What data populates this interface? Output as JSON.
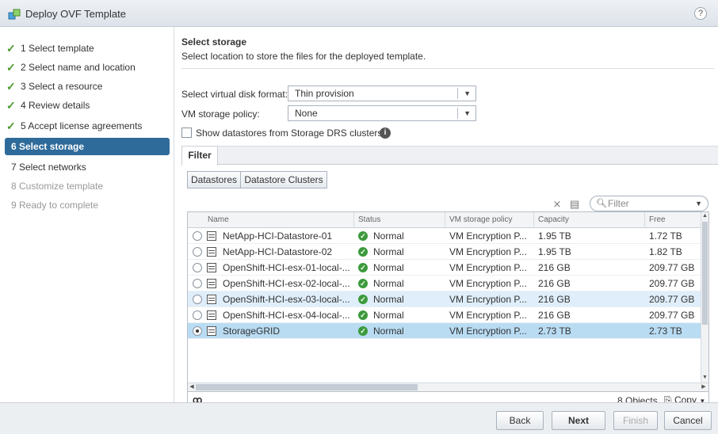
{
  "window": {
    "title": "Deploy OVF Template",
    "help": "?"
  },
  "steps": [
    {
      "label": "1  Select template",
      "state": "done"
    },
    {
      "label": "2  Select name and location",
      "state": "done"
    },
    {
      "label": "3  Select a resource",
      "state": "done"
    },
    {
      "label": "4  Review details",
      "state": "done"
    },
    {
      "label": "5  Accept license agreements",
      "state": "done"
    },
    {
      "label": "6  Select storage",
      "state": "active"
    },
    {
      "label": "7  Select networks",
      "state": "todo"
    },
    {
      "label": "8  Customize template",
      "state": "pending"
    },
    {
      "label": "9  Ready to complete",
      "state": "pending"
    }
  ],
  "main": {
    "title": "Select storage",
    "subtitle": "Select location to store the files for the deployed template.",
    "disk_format_label": "Select virtual disk format:",
    "disk_format_value": "Thin provision",
    "policy_label": "VM storage policy:",
    "policy_value": "None",
    "show_drs_label": "Show datastores from Storage DRS clusters",
    "filter_tab": "Filter",
    "segments": [
      "Datastores",
      "Datastore Clusters"
    ],
    "filter_placeholder": "Filter"
  },
  "table": {
    "columns": [
      "Name",
      "Status",
      "VM storage policy",
      "Capacity",
      "Free"
    ],
    "rows": [
      {
        "name": "NetApp-HCI-Datastore-01",
        "status": "Normal",
        "policy": "VM Encryption P...",
        "capacity": "1.95  TB",
        "free": "1.72  TB",
        "selected": false
      },
      {
        "name": "NetApp-HCI-Datastore-02",
        "status": "Normal",
        "policy": "VM Encryption P...",
        "capacity": "1.95  TB",
        "free": "1.82  TB",
        "selected": false
      },
      {
        "name": "OpenShift-HCI-esx-01-local-...",
        "status": "Normal",
        "policy": "VM Encryption P...",
        "capacity": "216  GB",
        "free": "209.77  GB",
        "selected": false
      },
      {
        "name": "OpenShift-HCI-esx-02-local-...",
        "status": "Normal",
        "policy": "VM Encryption P...",
        "capacity": "216  GB",
        "free": "209.77  GB",
        "selected": false
      },
      {
        "name": "OpenShift-HCI-esx-03-local-...",
        "status": "Normal",
        "policy": "VM Encryption P...",
        "capacity": "216  GB",
        "free": "209.77  GB",
        "selected": false
      },
      {
        "name": "OpenShift-HCI-esx-04-local-...",
        "status": "Normal",
        "policy": "VM Encryption P...",
        "capacity": "216  GB",
        "free": "209.77  GB",
        "selected": false
      },
      {
        "name": "StorageGRID",
        "status": "Normal",
        "policy": "VM Encryption P...",
        "capacity": "2.73  TB",
        "free": "2.73  TB",
        "selected": true
      }
    ],
    "object_count": "8 Objects",
    "copy_label": "Copy"
  },
  "buttons": {
    "back": "Back",
    "next": "Next",
    "finish": "Finish",
    "cancel": "Cancel"
  },
  "colors": {
    "active_step": "#2f6b9a",
    "check": "#4a9b2c",
    "selected_row": "#b9dcf3",
    "status_ok": "#3c9a3c"
  }
}
